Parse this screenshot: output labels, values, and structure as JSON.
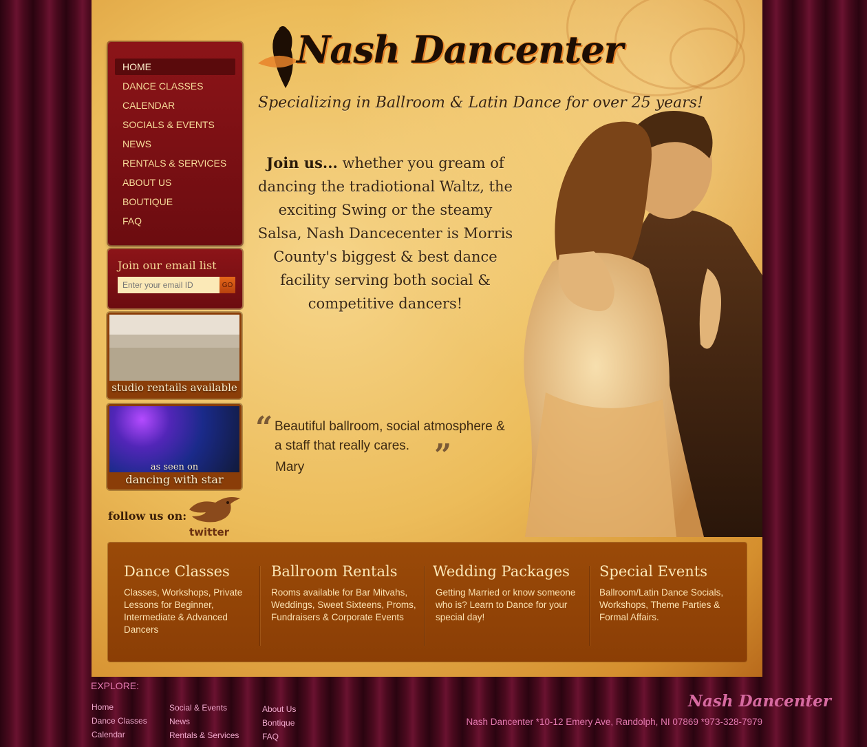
{
  "nav": {
    "items": [
      {
        "label": "HOME"
      },
      {
        "label": "DANCE CLASSES"
      },
      {
        "label": "CALENDAR"
      },
      {
        "label": "SOCIALS & EVENTS"
      },
      {
        "label": "NEWS"
      },
      {
        "label": "RENTALS & SERVICES"
      },
      {
        "label": "ABOUT US"
      },
      {
        "label": "BOUTIQUE"
      },
      {
        "label": "FAQ"
      }
    ],
    "active_index": 0
  },
  "email": {
    "title": "Join our email list",
    "placeholder": "Enter your email ID",
    "go_label": "GO"
  },
  "promos": {
    "rentals_label": "studio rentails available",
    "star_seen": "as seen on",
    "star_label": "dancing with star"
  },
  "twitter": {
    "follow_label": "follow us on:",
    "word": "twitter"
  },
  "header": {
    "logo_text": "Nash Dancenter",
    "tagline": "Specializing in Ballroom & Latin Dance for over 25 years!"
  },
  "intro": {
    "lead": "Join us...",
    "text": " whether you gream of dancing the tradiotional Waltz, the exciting Swing or the steamy Salsa, Nash Dancecenter is Morris County's biggest & best dance facility serving both social & competitive dancers!"
  },
  "testimonial": {
    "open_mark": "“",
    "close_mark": "”",
    "text": "Beautiful ballroom, social atmosphere & a staff that really cares.",
    "author": "Mary"
  },
  "features": [
    {
      "title": "Dance Classes",
      "desc": "Classes, Workshops, Private Lessons for Beginner, Intermediate & Advanced Dancers"
    },
    {
      "title": "Ballroom Rentals",
      "desc": "Rooms available for Bar Mitvahs, Weddings, Sweet Sixteens, Proms, Fundraisers & Corporate Events"
    },
    {
      "title": "Wedding Packages",
      "desc": "Getting Married or know someone who is? Learn to Dance for your special day!"
    },
    {
      "title": "Special Events",
      "desc": "Ballroom/Latin Dance Socials, Workshops, Theme Parties & Formal Affairs."
    }
  ],
  "footer": {
    "explore_label": "EXPLORE:",
    "col1": [
      "Home",
      "Dance Classes",
      "Calendar"
    ],
    "col2": [
      "Social & Events",
      "News",
      "Rentals & Services"
    ],
    "col3": [
      "About Us",
      "Bontique",
      "FAQ"
    ],
    "logo_text": "Nash Dancenter",
    "address": "Nash Dancenter *10-12 Emery Ave, Randolph, NI 07869 *973-328-7979"
  },
  "colors": {
    "curtain": "#4a0a1e",
    "nav_bg": "#8c1418",
    "parchment": "#ecbc5a",
    "features_bg": "#9a4a08",
    "footer_text": "#e479b0"
  }
}
